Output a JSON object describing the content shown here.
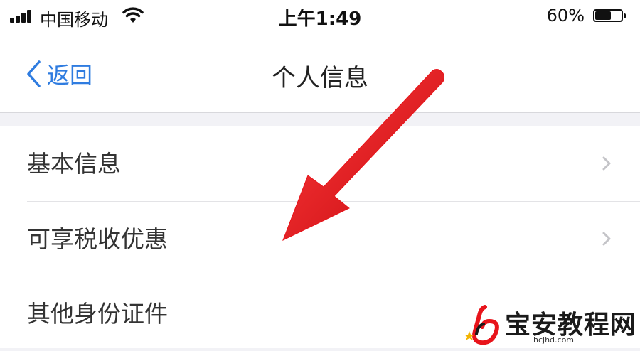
{
  "status_bar": {
    "carrier": "中国移动",
    "time": "上午1:49",
    "battery_percent": "60%",
    "battery_level": 0.6,
    "signal_icon": "signal-bars-icon",
    "wifi_icon": "wifi-icon"
  },
  "nav": {
    "back_label": "返回",
    "title": "个人信息",
    "accent_color": "#2f7ce0"
  },
  "list": {
    "items": [
      {
        "label": "基本信息",
        "has_chevron": true
      },
      {
        "label": "可享税收优惠",
        "has_chevron": true
      },
      {
        "label": "其他身份证件",
        "has_chevron": false
      }
    ]
  },
  "annotation": {
    "arrow_color": "#e8141b"
  },
  "watermark": {
    "name": "宝安教程网",
    "url": "hcjhd.com"
  }
}
